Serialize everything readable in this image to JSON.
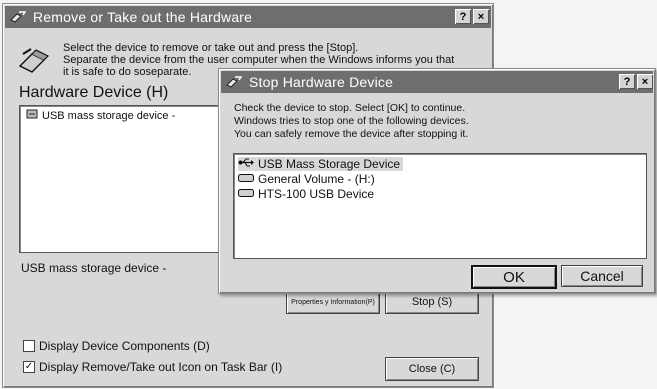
{
  "main_window": {
    "title": "Remove or  Take out the Hardware",
    "help_btn": "?",
    "close_btn": "×",
    "instruction_lines": [
      "Select the device to remove or take out and press the [Stop].",
      "Separate the device from the user computer when the Windows informs you that",
      "it is safe to do soseparate."
    ],
    "hardware_heading": "Hardware Device (H)",
    "devices": [
      "USB mass storage device -"
    ],
    "selected_device_label": "USB mass storage device -",
    "properties_button": "Properties y Information(P)",
    "stop_button": "Stop (S)",
    "option_components": "Display Device Components (D)",
    "option_components_checked": false,
    "option_taskbar": "Display Remove/Take out Icon on Task Bar (I)",
    "option_taskbar_checked": true,
    "close_button": "Close (C)"
  },
  "dialog": {
    "title": "Stop Hardware Device",
    "help_btn": "?",
    "close_btn": "×",
    "instruction_lines": [
      "Check the device to stop. Select [OK] to continue.",
      "Windows tries to stop one of the following devices.",
      "You can safely remove the device after stopping it."
    ],
    "devices": [
      "USB Mass Storage Device",
      "General Volume - (H:)",
      "HTS-100 USB Device"
    ],
    "ok_button": "OK",
    "cancel_button": "Cancel"
  }
}
